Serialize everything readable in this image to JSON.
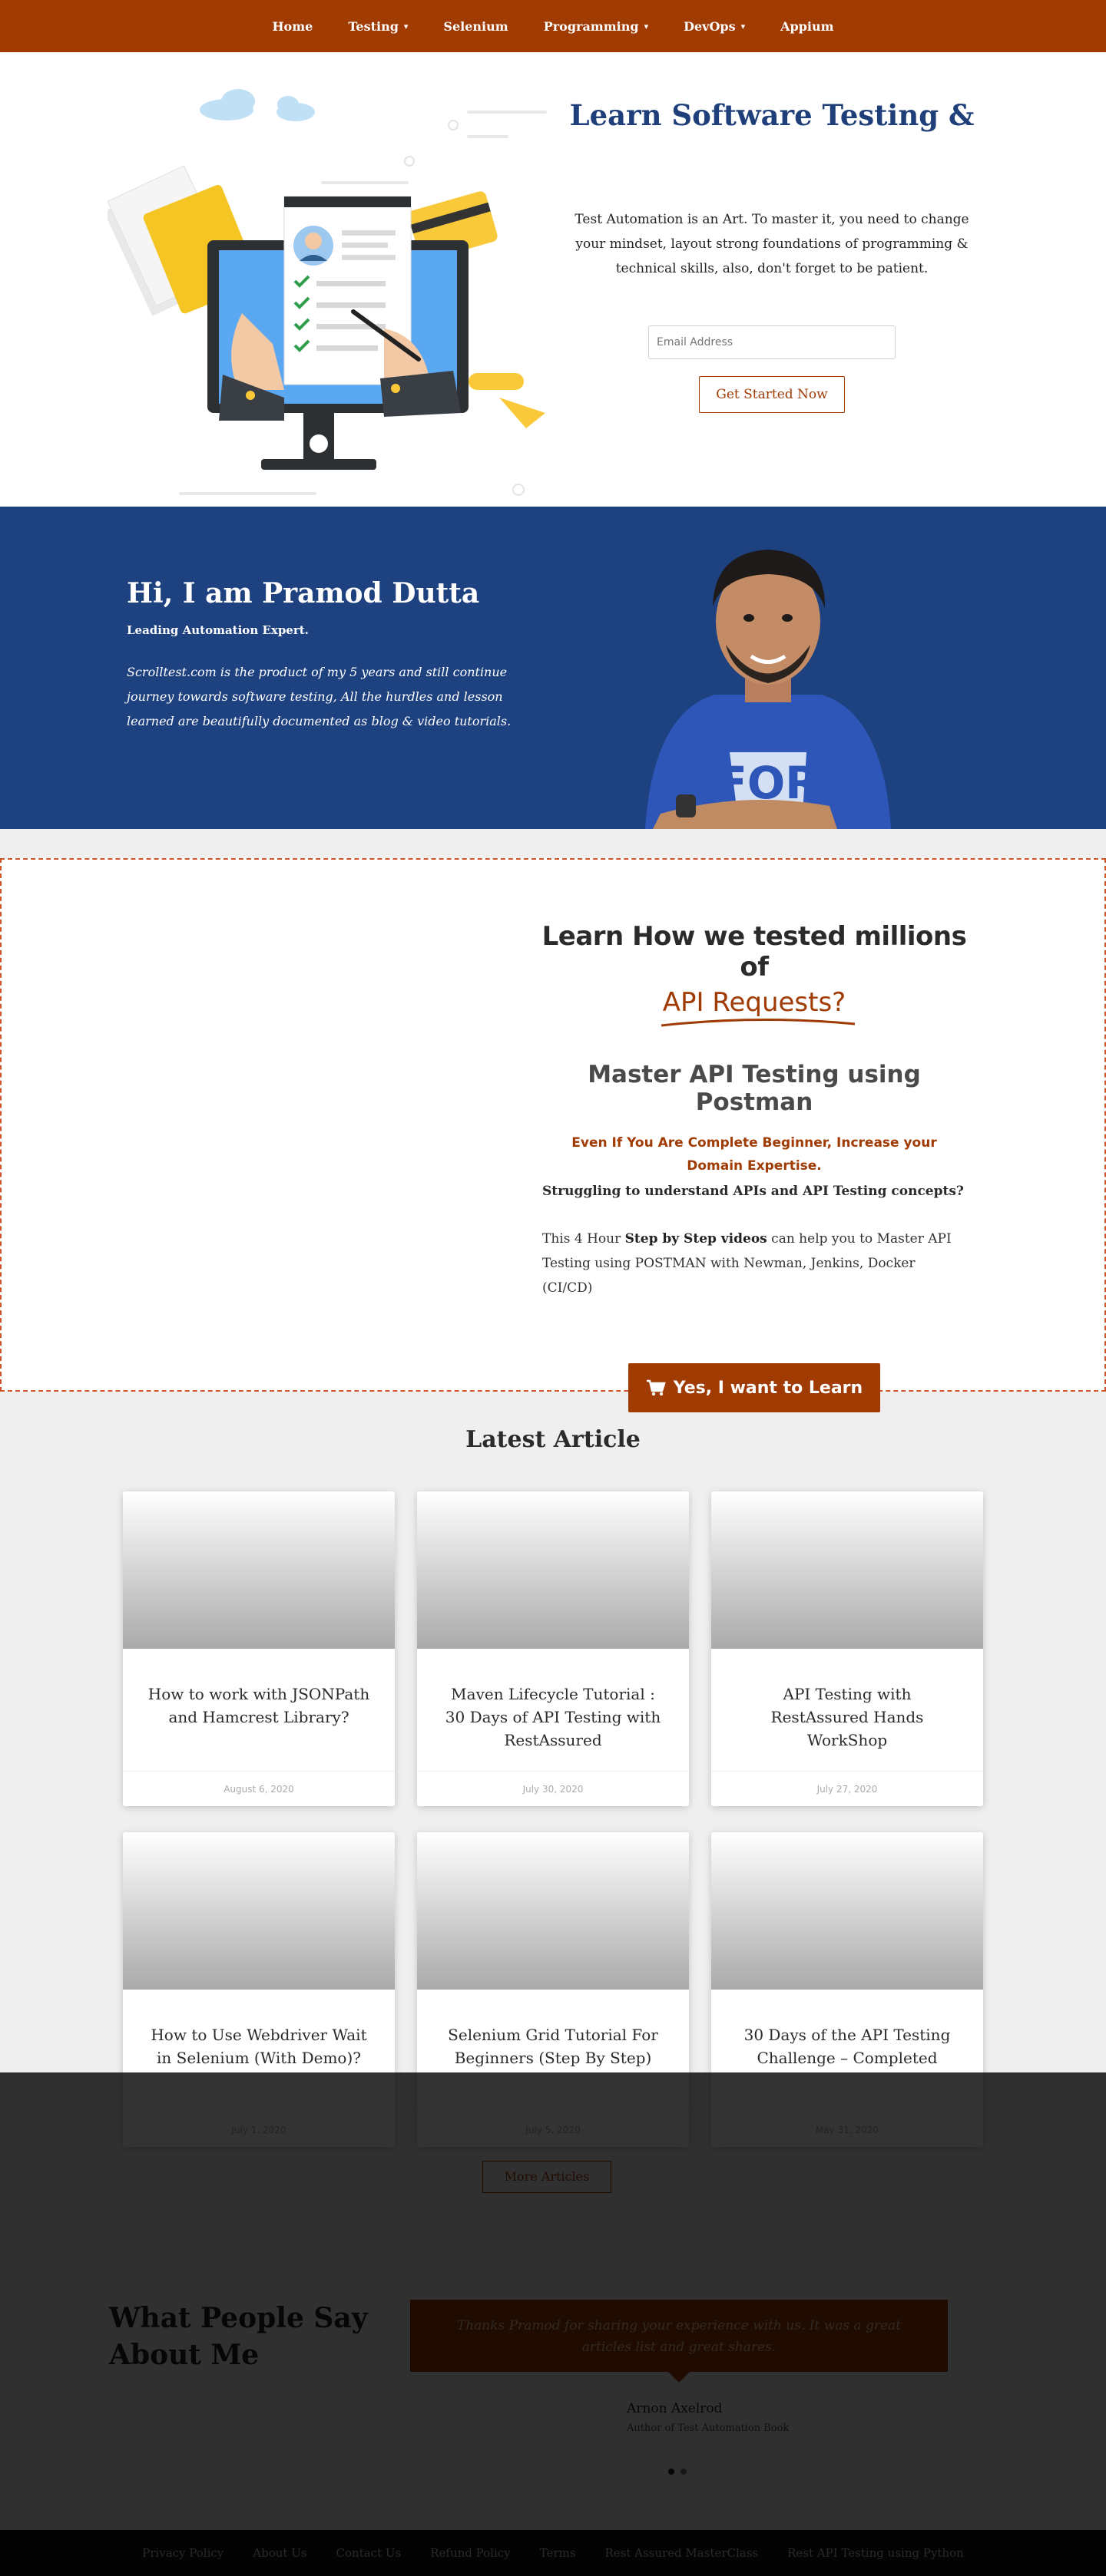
{
  "nav": {
    "items": [
      {
        "label": "Home",
        "dropdown": false
      },
      {
        "label": "Testing",
        "dropdown": true
      },
      {
        "label": "Selenium",
        "dropdown": false
      },
      {
        "label": "Programming",
        "dropdown": true
      },
      {
        "label": "DevOps",
        "dropdown": true
      },
      {
        "label": "Appium",
        "dropdown": false
      }
    ]
  },
  "hero": {
    "title": "Learn Software Testing &",
    "description": "Test Automation is an Art. To master it, you need to change your mindset, layout strong foundations of programming & technical skills, also, don't forget to be patient.",
    "email_placeholder": "Email Address",
    "cta_label": "Get Started Now"
  },
  "about": {
    "name": "Hi, I am Pramod Dutta",
    "role": "Leading Automation Expert.",
    "bio": "Scrolltest.com is the product of my 5 years and still continue journey towards software testing, All the hurdles and lesson learned are beautifully documented as blog & video tutorials."
  },
  "course": {
    "heading_line1": "Learn How we tested millions of",
    "heading_highlight": "API Requests?",
    "subheading": "Master API Testing using Postman",
    "tagline": "Even If You Are Complete Beginner, Increase your Domain Expertise.",
    "question": "Struggling to understand APIs and API Testing concepts?",
    "body_prefix": "This 4 Hour ",
    "body_bold": "Step by Step videos",
    "body_suffix": " can help you to Master API Testing using POSTMAN with Newman, Jenkins, Docker (CI/CD)",
    "cta_label": "Yes, I want to Learn"
  },
  "articles": {
    "title": "Latest Article",
    "items": [
      {
        "title": "How to work with JSONPath and Hamcrest Library?",
        "date": "August 6, 2020"
      },
      {
        "title": "Maven Lifecycle Tutorial : 30 Days of API Testing with RestAssured",
        "date": "July 30, 2020"
      },
      {
        "title": "API Testing with RestAssured Hands WorkShop",
        "date": "July 27, 2020"
      },
      {
        "title": "How to Use Webdriver Wait in Selenium (With Demo)?",
        "date": "July 1, 2020"
      },
      {
        "title": "Selenium Grid Tutorial For Beginners (Step By Step)",
        "date": "July 5, 2020"
      },
      {
        "title": "30 Days of the API Testing Challenge – Completed",
        "date": "May 31, 2020"
      }
    ],
    "more_label": "More Articles"
  },
  "testimonials": {
    "title": "What People Say About Me",
    "quote": "Thanks Pramod for sharing your experience with us. It was a great articles list and great shares.",
    "author": "Arnon Axelrod",
    "author_role": "Author of Test Automation Book",
    "slide_count": 2,
    "active_slide": 1
  },
  "footer": {
    "links": [
      "Privacy Policy",
      "About Us",
      "Contact Us",
      "Refund Policy",
      "Terms",
      "Rest Assured MasterClass",
      "Rest API Testing using Python"
    ]
  },
  "colors": {
    "brand": "#a03b04",
    "navy": "#1e4180",
    "title_blue": "#1e3f7a"
  }
}
